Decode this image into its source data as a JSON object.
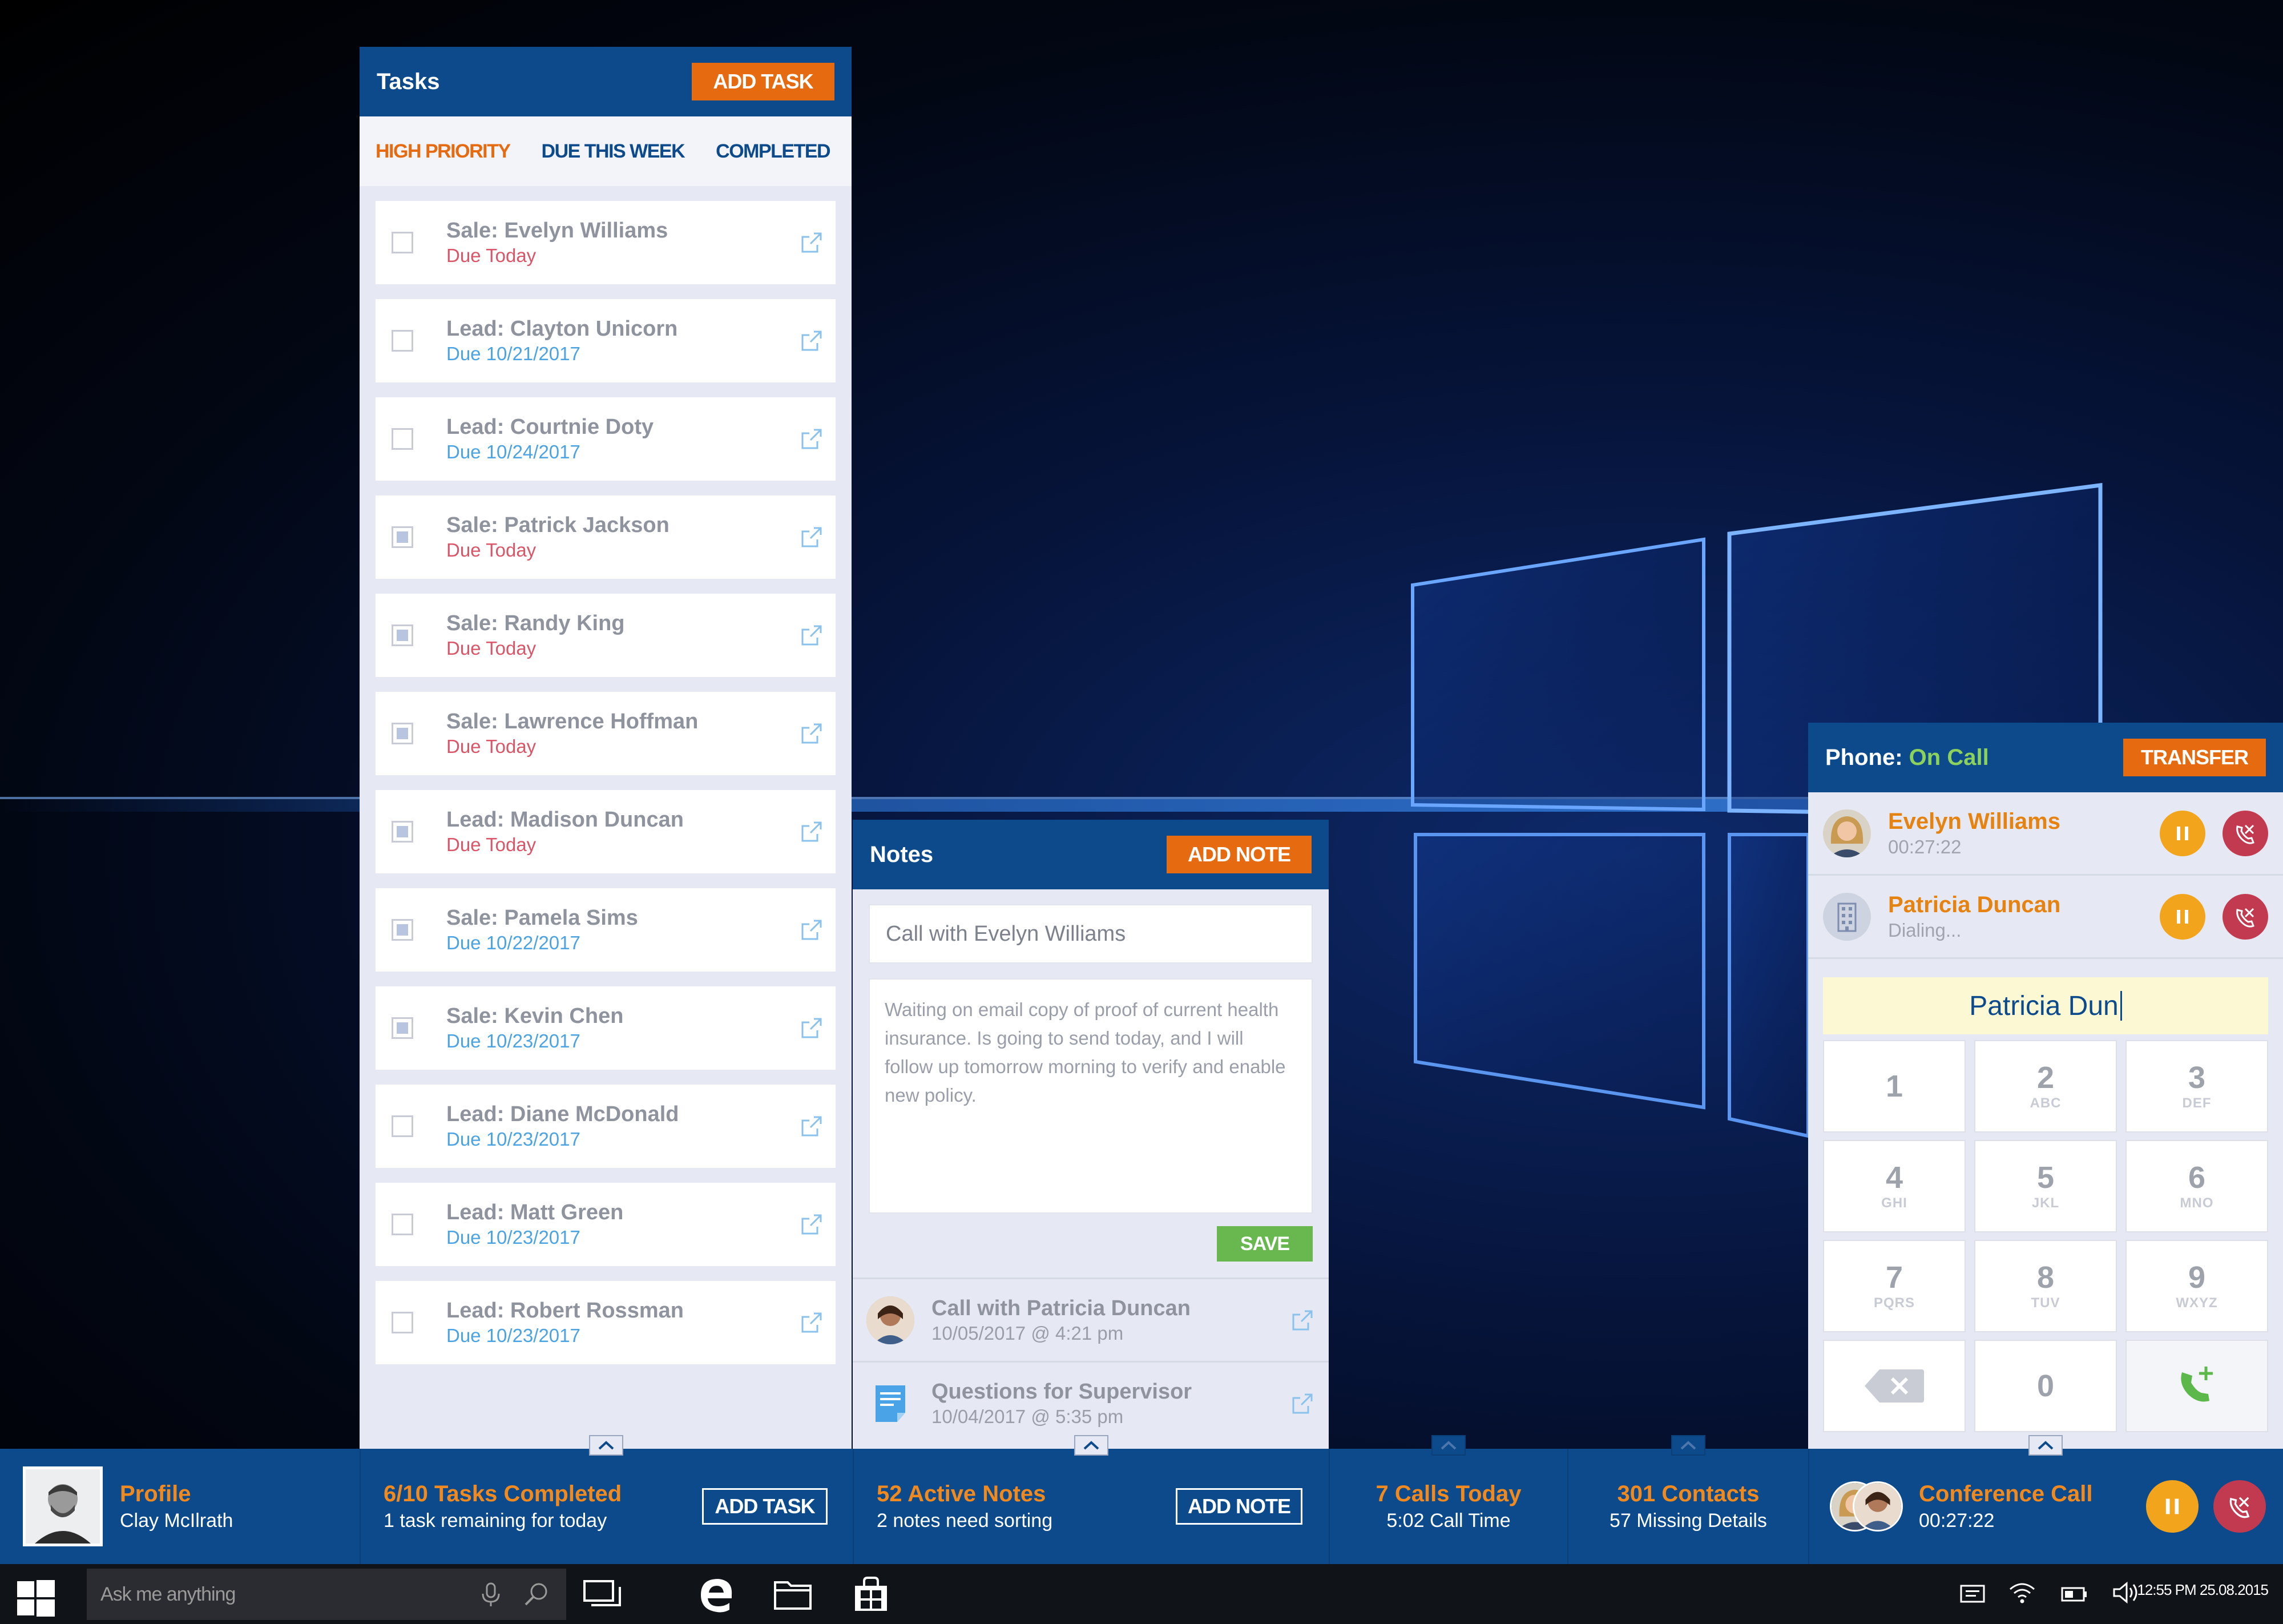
{
  "tasks": {
    "title": "Tasks",
    "add_label": "ADD TASK",
    "tabs": [
      "HIGH PRIORITY",
      "DUE THIS WEEK",
      "COMPLETED"
    ],
    "items": [
      {
        "name": "Sale: Evelyn Williams",
        "due": "Due Today",
        "checked": false
      },
      {
        "name": "Lead: Clayton Unicorn",
        "due": "Due 10/21/2017",
        "checked": false
      },
      {
        "name": "Lead: Courtnie Doty",
        "due": "Due 10/24/2017",
        "checked": false
      },
      {
        "name": "Sale: Patrick Jackson",
        "due": "Due Today",
        "checked": true
      },
      {
        "name": "Sale: Randy King",
        "due": "Due Today",
        "checked": true
      },
      {
        "name": "Sale: Lawrence Hoffman",
        "due": "Due Today",
        "checked": true
      },
      {
        "name": "Lead: Madison Duncan",
        "due": "Due Today",
        "checked": true
      },
      {
        "name": "Sale: Pamela Sims",
        "due": "Due 10/22/2017",
        "checked": true
      },
      {
        "name": "Sale: Kevin Chen",
        "due": "Due 10/23/2017",
        "checked": true
      },
      {
        "name": "Lead: Diane McDonald",
        "due": "Due 10/23/2017",
        "checked": false
      },
      {
        "name": "Lead: Matt Green",
        "due": "Due 10/23/2017",
        "checked": false
      },
      {
        "name": "Lead: Robert Rossman",
        "due": "Due 10/23/2017",
        "checked": false
      }
    ]
  },
  "notes": {
    "title": "Notes",
    "add_label": "ADD NOTE",
    "title_value": "Call with Evelyn Williams",
    "body_value": "Waiting on email copy of proof of current health insurance. Is going to send today, and I will follow up tomorrow morning to verify and enable new policy.",
    "save_label": "SAVE",
    "items": [
      {
        "title": "Call with Patricia Duncan",
        "date": "10/05/2017 @ 4:21 pm"
      },
      {
        "title": "Questions for Supervisor",
        "date": "10/04/2017 @ 5:35 pm"
      }
    ]
  },
  "phone": {
    "title_prefix": "Phone:",
    "status": "On Call",
    "transfer_label": "TRANSFER",
    "calls": [
      {
        "name": "Evelyn Williams",
        "sub": "00:27:22"
      },
      {
        "name": "Patricia Duncan",
        "sub": "Dialing..."
      }
    ],
    "dial_value": "Patricia Dun",
    "keys": [
      {
        "num": "1",
        "letters": ""
      },
      {
        "num": "2",
        "letters": "ABC"
      },
      {
        "num": "3",
        "letters": "DEF"
      },
      {
        "num": "4",
        "letters": "GHI"
      },
      {
        "num": "5",
        "letters": "JKL"
      },
      {
        "num": "6",
        "letters": "MNO"
      },
      {
        "num": "7",
        "letters": "PQRS"
      },
      {
        "num": "8",
        "letters": "TUV"
      },
      {
        "num": "9",
        "letters": "WXYZ"
      }
    ],
    "zero": "0"
  },
  "bottombar": {
    "profile": {
      "title": "Profile",
      "name": "Clay McIlrath"
    },
    "tasks": {
      "title": "6/10 Tasks Completed",
      "sub": "1 task remaining for today",
      "button": "ADD TASK"
    },
    "notes": {
      "title": "52 Active Notes",
      "sub": "2 notes need sorting",
      "button": "ADD NOTE"
    },
    "calls": {
      "title": "7 Calls Today",
      "sub": "5:02 Call Time"
    },
    "contacts": {
      "title": "301 Contacts",
      "sub": "57 Missing Details"
    },
    "conference": {
      "title": "Conference Call",
      "sub": "00:27:22"
    }
  },
  "taskbar": {
    "search_placeholder": "Ask me anything",
    "clock": "12:55 PM 25.08.2015"
  },
  "colors": {
    "brand_blue": "#0c4a8c",
    "accent_orange": "#e66a0f",
    "save_green": "#69b84f",
    "on_call_green": "#8bd15c",
    "hangup_red": "#c23a50",
    "hold_yellow": "#f2a51c"
  }
}
